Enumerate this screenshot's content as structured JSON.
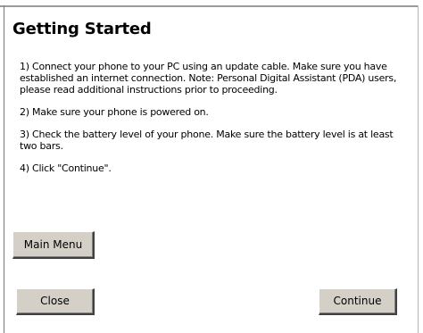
{
  "panel": {
    "title": "Getting Started"
  },
  "steps": [
    "1) Connect your phone to your PC using an update cable. Make sure you have established an internet connection. Note: Personal Digital Assistant (PDA) users, please read additional instructions prior to proceeding.",
    "2) Make sure your phone is powered on.",
    "3) Check the battery level of your phone. Make sure the battery level is at least two bars.",
    "4) Click \"Continue\"."
  ],
  "buttons": {
    "main_menu": "Main Menu",
    "close": "Close",
    "continue": "Continue"
  },
  "colors": {
    "button_face": "#d4d0c8",
    "background": "#ffffff",
    "border": "#9a9a9a"
  }
}
